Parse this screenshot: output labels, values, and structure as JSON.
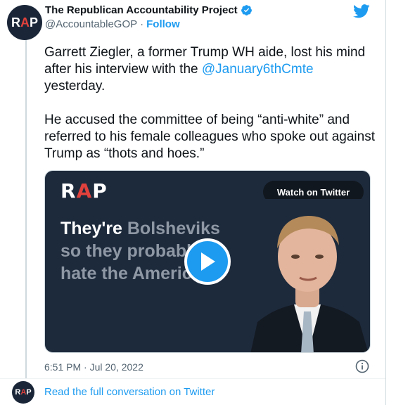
{
  "author": {
    "display_name": "The Republican Accountability Project",
    "handle": "@AccountableGOP",
    "separator": "·",
    "follow_label": "Follow",
    "avatar_text": {
      "r": "R",
      "a": "A",
      "p": "P"
    }
  },
  "tweet": {
    "para1_before": "Garrett Ziegler, a former Trump WH aide, lost his mind after his interview with the ",
    "mention": "@January6thCmte",
    "para1_after": " yesterday.",
    "para2": "He accused the committee of being “anti-white” and referred to his female colleagues who spoke out against Trump as “thots and hoes.”"
  },
  "media": {
    "logo": {
      "r": "R",
      "a": "A",
      "p": "P"
    },
    "watch_label": "Watch on Twitter",
    "quote_white": "They're ",
    "quote_gray": "Bolsheviks so they probably do hate the American"
  },
  "timestamp": "6:51 PM · Jul 20, 2022",
  "footer": {
    "link_text": "Read the full conversation on Twitter",
    "avatar_text": {
      "r": "R",
      "a": "A",
      "p": "P"
    }
  },
  "colors": {
    "accent": "#1d9bf0",
    "brand_red": "#e0413c",
    "brand_navy": "#1a2638"
  },
  "icons": [
    "verified-badge-icon",
    "twitter-bird-icon",
    "play-icon",
    "info-icon"
  ]
}
